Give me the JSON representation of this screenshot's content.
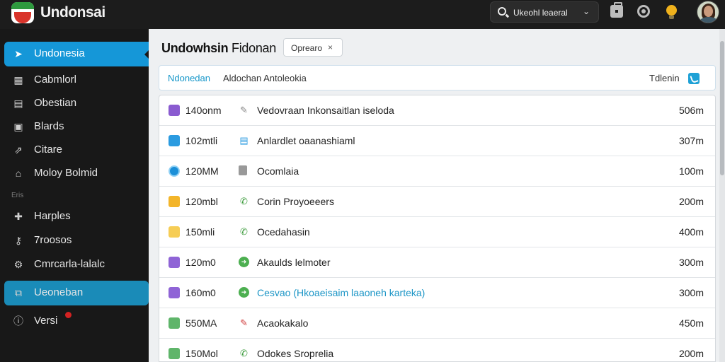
{
  "app": {
    "title": "Undonsai",
    "search_value": "Ukeohl leaeral",
    "colors": {
      "accent": "#1597d8",
      "topbar": "#1c1c1c",
      "sidebar": "#181818"
    }
  },
  "topbar": {
    "icons": [
      "search-icon",
      "chevron-down-icon",
      "briefcase-icon",
      "help-icon",
      "lightbulb-icon",
      "avatar"
    ]
  },
  "sidebar": {
    "items": [
      {
        "label": "Undonesia",
        "icon": "send-icon",
        "active": true
      },
      {
        "label": "Cabmlorl",
        "icon": "calendar-icon"
      },
      {
        "label": "Obestian",
        "icon": "list-icon"
      },
      {
        "label": "Blards",
        "icon": "board-icon"
      },
      {
        "label": "Citare",
        "icon": "share-icon"
      },
      {
        "label": "Moloy Bolmid",
        "icon": "home-icon"
      },
      {
        "label": "Harples",
        "icon": "tag-icon"
      },
      {
        "label": "7roosos",
        "icon": "key-icon"
      },
      {
        "label": "Cmrcarla-lalalc",
        "icon": "tools-icon"
      },
      {
        "label": "Ueoneban",
        "icon": "window-icon",
        "selected": true
      },
      {
        "label": "Versi",
        "icon": "info-icon"
      }
    ],
    "section_label": "Eris"
  },
  "main": {
    "title_bold": "Undowhsin",
    "title_light": "Fidonan",
    "filter_chip": {
      "label": "Oprearo",
      "close": "×"
    },
    "info": {
      "highlight": "Ndonedan",
      "text": "Aldochan Antoleokia",
      "right_label": "Tdlenin"
    },
    "rows": [
      {
        "size": "140onm",
        "name": "Vedovraan Inkonsaitlan iseloda",
        "value": "506m",
        "icon": "folder-purple-icon",
        "glyph": "link-icon",
        "glyph_char": "✎",
        "link": false
      },
      {
        "size": "102mtli",
        "name": "Anlardlet oaanashiaml",
        "value": "307m",
        "icon": "folder-blue-icon",
        "glyph": "document-list-icon",
        "glyph_char": "▤",
        "link": false
      },
      {
        "size": "120MM",
        "name": "Ocomlaia",
        "value": "100m",
        "icon": "globe-icon",
        "glyph": "file-icon",
        "glyph_char": "",
        "link": false
      },
      {
        "size": "120mbl",
        "name": "Corin Proyoeeers",
        "value": "200m",
        "icon": "folder-gold-icon",
        "glyph": "phone-icon",
        "glyph_char": "✆",
        "link": false
      },
      {
        "size": "150mli",
        "name": "Ocedahasin",
        "value": "400m",
        "icon": "folder-yellow-icon",
        "glyph": "phone-icon",
        "glyph_char": "✆",
        "link": false
      },
      {
        "size": "120m0",
        "name": "Akaulds lelmoter",
        "value": "300m",
        "icon": "folder-violet-icon",
        "glyph": "arrow-circle-icon",
        "glyph_char": "➜",
        "link": false
      },
      {
        "size": "160m0",
        "name": "Cesvao (Hkoaeisaim laaoneh karteka)",
        "value": "300m",
        "icon": "folder-violet-icon",
        "glyph": "arrow-circle-icon",
        "glyph_char": "➜",
        "link": true
      },
      {
        "size": "550MA",
        "name": "Acaokakalo",
        "value": "450m",
        "icon": "chart-green-icon",
        "glyph": "pin-icon",
        "glyph_char": "✎",
        "link": false
      },
      {
        "size": "150Mol",
        "name": "Odokes Sroprelia",
        "value": "200m",
        "icon": "chart-green-icon",
        "glyph": "phone-icon",
        "glyph_char": "✆",
        "link": false
      }
    ]
  }
}
